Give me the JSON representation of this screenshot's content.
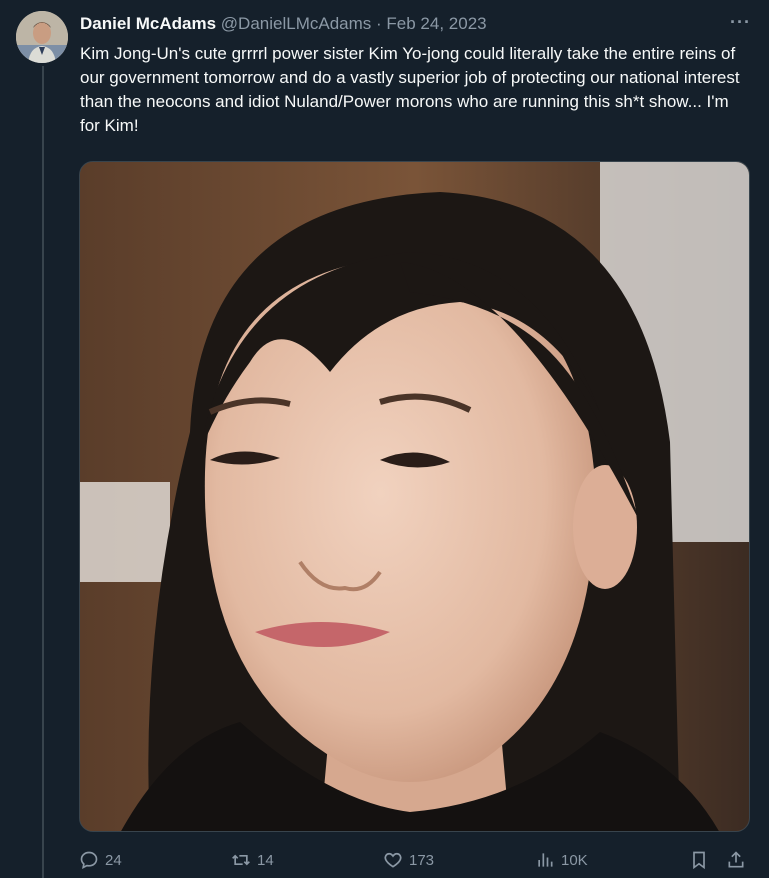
{
  "tweet": {
    "author_name": "Daniel McAdams",
    "handle": "@DanielLMcAdams",
    "separator": "·",
    "date": "Feb 24, 2023",
    "more_label": "···",
    "text": "Kim Jong-Un's cute grrrrl power sister Kim Yo-jong could literally take the entire reins of our government tomorrow and do a vastly superior job of protecting our national interest than the neocons and idiot Nuland/Power morons who are running this sh*t show... I'm for Kim!"
  },
  "actions": {
    "replies": "24",
    "retweets": "14",
    "likes": "173",
    "views": "10K"
  },
  "icons": [
    "reply-icon",
    "retweet-icon",
    "like-icon",
    "views-icon",
    "bookmark-icon",
    "share-icon"
  ],
  "colors": {
    "background": "#15202b",
    "muted_text": "#8b98a5",
    "primary_text": "#f7f9f9",
    "border": "#38444d"
  }
}
